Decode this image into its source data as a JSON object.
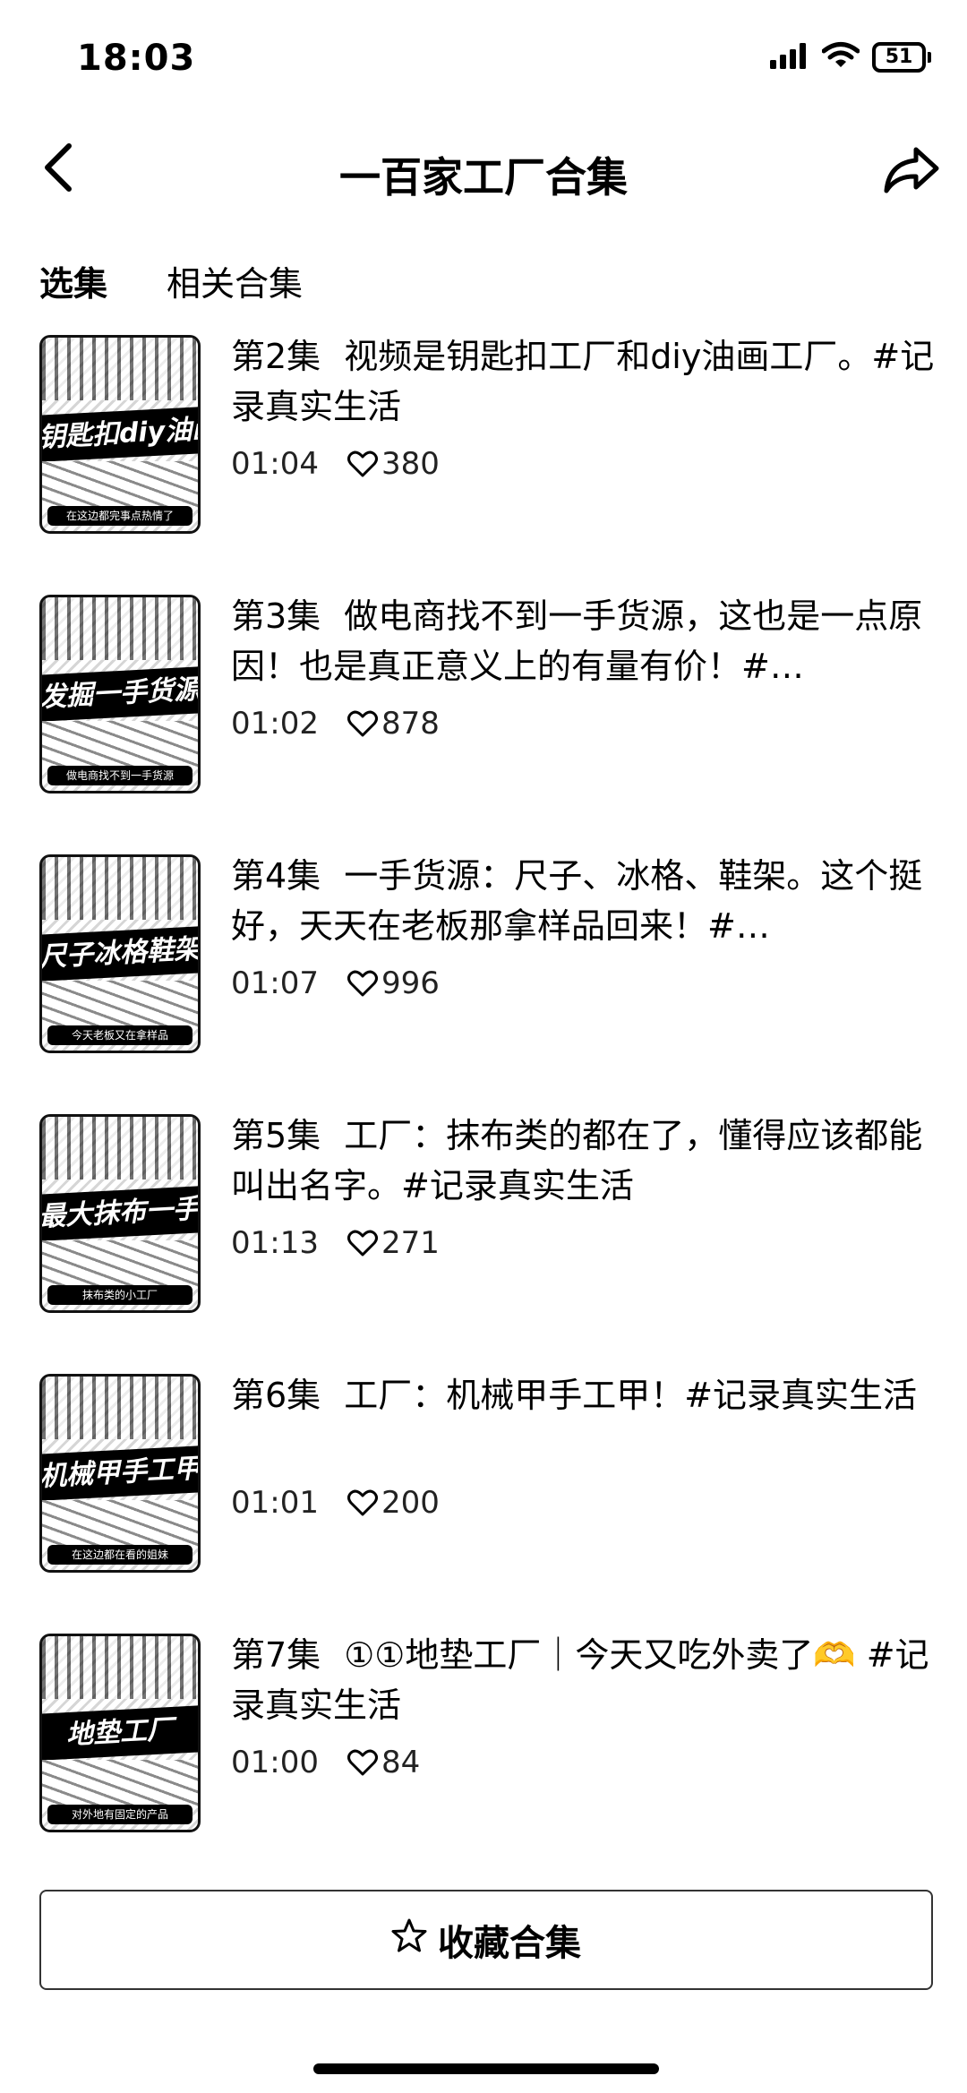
{
  "status_bar": {
    "time": "18:03",
    "battery_level": "51",
    "icons": [
      "signal-icon",
      "wifi-icon",
      "battery-icon"
    ]
  },
  "header": {
    "title": "一百家工厂合集",
    "back_icon": "chevron-left-icon",
    "share_icon": "share-arrow-icon"
  },
  "tabs": [
    {
      "label": "选集",
      "active": true
    },
    {
      "label": "相关合集",
      "active": false
    }
  ],
  "episodes": [
    {
      "episode": "第2集",
      "title": "视频是钥匙扣工厂和diy油画工厂。#记录真实生活",
      "duration": "01:04",
      "likes": "380",
      "thumb_banner": "钥匙扣diy油画",
      "thumb_caption": "在这边都完事点热情了"
    },
    {
      "episode": "第3集",
      "title": "做电商找不到一手货源，这也是一点原因！也是真正意义上的有量有价！#…",
      "duration": "01:02",
      "likes": "878",
      "thumb_banner": "发掘一手货源",
      "thumb_caption": "做电商找不到一手货源"
    },
    {
      "episode": "第4集",
      "title": "一手货源：尺子、冰格、鞋架。这个挺好，天天在老板那拿样品回来！#…",
      "duration": "01:07",
      "likes": "996",
      "thumb_banner": "尺子冰格鞋架",
      "thumb_caption": "今天老板又在拿样品"
    },
    {
      "episode": "第5集",
      "title": "工厂：抹布类的都在了，懂得应该都能叫出名字。#记录真实生活",
      "duration": "01:13",
      "likes": "271",
      "thumb_banner": "最大抹布一手货源",
      "thumb_caption": "抹布类的小工厂"
    },
    {
      "episode": "第6集",
      "title": "工厂：机械甲手工甲！#记录真实生活",
      "duration": "01:01",
      "likes": "200",
      "thumb_banner": "机械甲手工甲",
      "thumb_caption": "在这边都在看的姐妹"
    },
    {
      "episode": "第7集",
      "title": "①①地垫工厂｜今天又吃外卖了🫶 #记录真实生活",
      "duration": "01:00",
      "likes": "84",
      "thumb_banner": "地垫工厂",
      "thumb_caption": "对外地有固定的产品"
    }
  ],
  "collect_button": {
    "label": "收藏合集",
    "icon": "star-outline-icon"
  }
}
